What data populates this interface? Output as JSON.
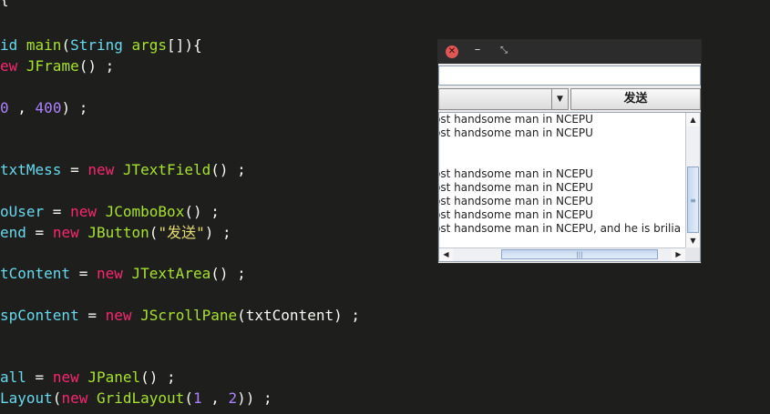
{
  "editor": {
    "lines": [
      {
        "parts": [
          {
            "c": "plain",
            "t": "{"
          }
        ]
      },
      {
        "parts": []
      },
      {
        "parts": [
          {
            "c": "kw2",
            "t": "id "
          },
          {
            "c": "cls",
            "t": "main"
          },
          {
            "c": "plain",
            "t": "("
          },
          {
            "c": "id",
            "t": "String"
          },
          {
            "c": "plain",
            "t": " "
          },
          {
            "c": "cls",
            "t": "args"
          },
          {
            "c": "plain",
            "t": "[]){"
          }
        ]
      },
      {
        "parts": [
          {
            "c": "kw",
            "t": "ew "
          },
          {
            "c": "cls",
            "t": "JFrame"
          },
          {
            "c": "plain",
            "t": "() ;"
          }
        ]
      },
      {
        "parts": []
      },
      {
        "parts": [
          {
            "c": "num",
            "t": "0"
          },
          {
            "c": "plain",
            "t": " , "
          },
          {
            "c": "num",
            "t": "400"
          },
          {
            "c": "plain",
            "t": ") ;"
          }
        ]
      },
      {
        "parts": []
      },
      {
        "parts": []
      },
      {
        "parts": [
          {
            "c": "id",
            "t": "txtMess"
          },
          {
            "c": "plain",
            "t": " = "
          },
          {
            "c": "kw",
            "t": "new"
          },
          {
            "c": "plain",
            "t": " "
          },
          {
            "c": "cls",
            "t": "JTextField"
          },
          {
            "c": "plain",
            "t": "() ;"
          }
        ]
      },
      {
        "parts": []
      },
      {
        "parts": [
          {
            "c": "id",
            "t": "oUser"
          },
          {
            "c": "plain",
            "t": " = "
          },
          {
            "c": "kw",
            "t": "new"
          },
          {
            "c": "plain",
            "t": " "
          },
          {
            "c": "cls",
            "t": "JComboBox"
          },
          {
            "c": "plain",
            "t": "() ;"
          }
        ]
      },
      {
        "parts": [
          {
            "c": "id",
            "t": "end"
          },
          {
            "c": "plain",
            "t": " = "
          },
          {
            "c": "kw",
            "t": "new"
          },
          {
            "c": "plain",
            "t": " "
          },
          {
            "c": "cls",
            "t": "JButton"
          },
          {
            "c": "plain",
            "t": "("
          },
          {
            "c": "str",
            "t": "\"发送\""
          },
          {
            "c": "plain",
            "t": ") ;"
          }
        ]
      },
      {
        "parts": []
      },
      {
        "parts": [
          {
            "c": "id",
            "t": "tContent"
          },
          {
            "c": "plain",
            "t": " = "
          },
          {
            "c": "kw",
            "t": "new"
          },
          {
            "c": "plain",
            "t": " "
          },
          {
            "c": "cls",
            "t": "JTextArea"
          },
          {
            "c": "plain",
            "t": "() ;"
          }
        ]
      },
      {
        "parts": []
      },
      {
        "parts": [
          {
            "c": "id",
            "t": "spContent"
          },
          {
            "c": "plain",
            "t": " = "
          },
          {
            "c": "kw",
            "t": "new"
          },
          {
            "c": "plain",
            "t": " "
          },
          {
            "c": "cls",
            "t": "JScrollPane"
          },
          {
            "c": "plain",
            "t": "(txtContent) ;"
          }
        ]
      },
      {
        "parts": []
      },
      {
        "parts": []
      },
      {
        "parts": [
          {
            "c": "id",
            "t": "all"
          },
          {
            "c": "plain",
            "t": " = "
          },
          {
            "c": "kw",
            "t": "new"
          },
          {
            "c": "plain",
            "t": " "
          },
          {
            "c": "cls",
            "t": "JPanel"
          },
          {
            "c": "plain",
            "t": "() ;"
          }
        ]
      },
      {
        "parts": [
          {
            "c": "id",
            "t": "Layout"
          },
          {
            "c": "plain",
            "t": "("
          },
          {
            "c": "kw",
            "t": "new"
          },
          {
            "c": "plain",
            "t": " "
          },
          {
            "c": "cls",
            "t": "GridLayout"
          },
          {
            "c": "plain",
            "t": "("
          },
          {
            "c": "num",
            "t": "1"
          },
          {
            "c": "plain",
            "t": " , "
          },
          {
            "c": "num",
            "t": "2"
          },
          {
            "c": "plain",
            "t": ")) ;"
          }
        ]
      }
    ]
  },
  "window": {
    "titlebar": {
      "close_glyph": "✕",
      "min_glyph": "–",
      "max_glyph": "⤡"
    },
    "text_field": {
      "value": ""
    },
    "combo": {
      "selected": ""
    },
    "send_button": {
      "label": "发送"
    },
    "text_area": {
      "lines": [
        "ost handsome man in NCEPU",
        "ost handsome man in NCEPU",
        "",
        "",
        "ost handsome man in NCEPU",
        "ost handsome man in NCEPU",
        "ost handsome man in NCEPU",
        "ost handsome man in NCEPU",
        "ost handsome man in NCEPU, and he is brilia"
      ]
    },
    "scroll": {
      "up_glyph": "▲",
      "down_glyph": "▼",
      "left_glyph": "◀",
      "right_glyph": "▶",
      "grip_v": "≡",
      "grip_h": "|||"
    }
  }
}
